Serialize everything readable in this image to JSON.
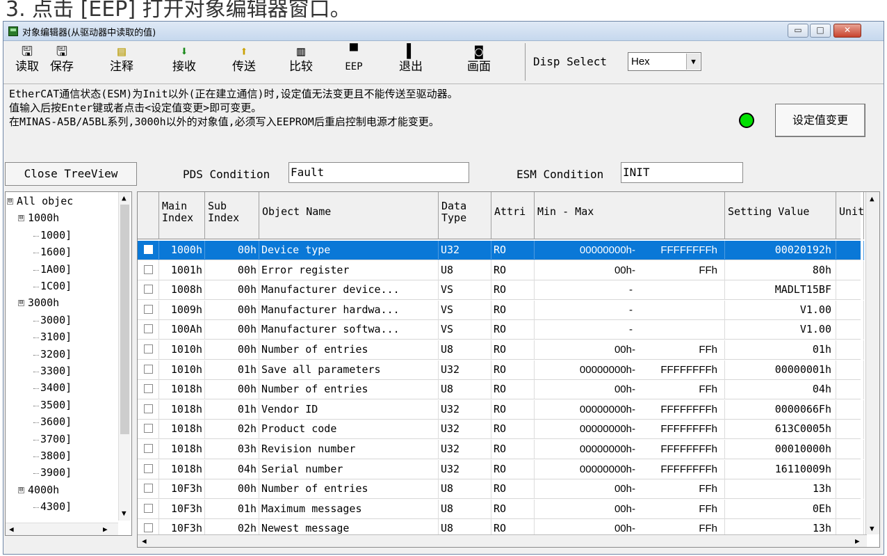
{
  "heading_fragment": "3. 点击 [EEP] 打开对象编辑器窗口。",
  "window": {
    "title": "对象编辑器(从驱动器中读取的值)",
    "min_label": "▭",
    "max_label": "□",
    "close_label": "✕"
  },
  "toolbar": {
    "buttons": [
      {
        "label": "读取",
        "icon": "save-floppy-icon"
      },
      {
        "label": "保存",
        "icon": "save-floppy-icon"
      },
      {
        "label": "注释",
        "icon": "note-icon"
      },
      {
        "label": "接收",
        "icon": "receive-icon"
      },
      {
        "label": "传送",
        "icon": "send-icon"
      },
      {
        "label": "比较",
        "icon": "compare-icon"
      },
      {
        "label": "EEP",
        "icon": "eep-icon"
      },
      {
        "label": "退出",
        "icon": "exit-icon"
      },
      {
        "label": "画面",
        "icon": "screen-capture-icon"
      }
    ],
    "disp_select_label": "Disp Select",
    "disp_select_value": "Hex"
  },
  "info_lines": [
    "EtherCAT通信状态(ESM)为Init以外(正在建立通信)时,设定值无法变更且不能传送至驱动器。",
    "值输入后按Enter键或者点击<设定值变更>即可变更。",
    "在MINAS-A5B/A5BL系列,3000h以外的对象值,必须写入EEPROM后重启控制电源才能变更。"
  ],
  "status_led_color": "#00e000",
  "change_button_label": "设定值变更",
  "close_tree_label": "Close TreeView",
  "pds": {
    "label": "PDS Condition",
    "value": "Fault"
  },
  "esm": {
    "label": "ESM Condition",
    "value": "INIT"
  },
  "tree": [
    {
      "text": "All objec",
      "level": 0,
      "box": "⊟"
    },
    {
      "text": "1000h",
      "level": 1,
      "box": "⊟"
    },
    {
      "text": "1000]",
      "level": 2
    },
    {
      "text": "1600]",
      "level": 2
    },
    {
      "text": "1A00]",
      "level": 2
    },
    {
      "text": "1C00]",
      "level": 2
    },
    {
      "text": "3000h",
      "level": 1,
      "box": "⊟"
    },
    {
      "text": "3000]",
      "level": 2
    },
    {
      "text": "3100]",
      "level": 2
    },
    {
      "text": "3200]",
      "level": 2
    },
    {
      "text": "3300]",
      "level": 2
    },
    {
      "text": "3400]",
      "level": 2
    },
    {
      "text": "3500]",
      "level": 2
    },
    {
      "text": "3600]",
      "level": 2
    },
    {
      "text": "3700]",
      "level": 2
    },
    {
      "text": "3800]",
      "level": 2
    },
    {
      "text": "3900]",
      "level": 2
    },
    {
      "text": "4000h",
      "level": 1,
      "box": "⊟"
    },
    {
      "text": "4300]",
      "level": 2
    }
  ],
  "table": {
    "headers": {
      "main": "Main\nIndex",
      "sub": "Sub\nIndex",
      "name": "Object Name",
      "dtype": "Data\nType",
      "attr": "Attri",
      "minmax": "Min - Max",
      "setting": "Setting Value",
      "unit": "Unit"
    },
    "rows": [
      {
        "main": "1000h",
        "sub": "00h",
        "name": "Device type",
        "type": "U32",
        "attr": "RO",
        "min": "00000000h-",
        "max": "FFFFFFFFh",
        "value": "00020192h",
        "selected": true
      },
      {
        "main": "1001h",
        "sub": "00h",
        "name": "Error register",
        "type": "U8",
        "attr": "RO",
        "min": "00h-",
        "max": "FFh",
        "value": "80h"
      },
      {
        "main": "1008h",
        "sub": "00h",
        "name": "Manufacturer device...",
        "type": "VS",
        "attr": "RO",
        "min": "-",
        "max": "",
        "value": "MADLT15BF"
      },
      {
        "main": "1009h",
        "sub": "00h",
        "name": "Manufacturer hardwa...",
        "type": "VS",
        "attr": "RO",
        "min": "-",
        "max": "",
        "value": "V1.00"
      },
      {
        "main": "100Ah",
        "sub": "00h",
        "name": "Manufacturer softwa...",
        "type": "VS",
        "attr": "RO",
        "min": "-",
        "max": "",
        "value": "V1.00"
      },
      {
        "main": "1010h",
        "sub": "00h",
        "name": "Number of entries",
        "type": "U8",
        "attr": "RO",
        "min": "00h-",
        "max": "FFh",
        "value": "01h"
      },
      {
        "main": "1010h",
        "sub": "01h",
        "name": "Save all parameters",
        "type": "U32",
        "attr": "RO",
        "min": "00000000h-",
        "max": "FFFFFFFFh",
        "value": "00000001h"
      },
      {
        "main": "1018h",
        "sub": "00h",
        "name": "Number of entries",
        "type": "U8",
        "attr": "RO",
        "min": "00h-",
        "max": "FFh",
        "value": "04h"
      },
      {
        "main": "1018h",
        "sub": "01h",
        "name": "Vendor ID",
        "type": "U32",
        "attr": "RO",
        "min": "00000000h-",
        "max": "FFFFFFFFh",
        "value": "0000066Fh"
      },
      {
        "main": "1018h",
        "sub": "02h",
        "name": "Product code",
        "type": "U32",
        "attr": "RO",
        "min": "00000000h-",
        "max": "FFFFFFFFh",
        "value": "613C0005h"
      },
      {
        "main": "1018h",
        "sub": "03h",
        "name": "Revision number",
        "type": "U32",
        "attr": "RO",
        "min": "00000000h-",
        "max": "FFFFFFFFh",
        "value": "00010000h"
      },
      {
        "main": "1018h",
        "sub": "04h",
        "name": "Serial number",
        "type": "U32",
        "attr": "RO",
        "min": "00000000h-",
        "max": "FFFFFFFFh",
        "value": "16110009h"
      },
      {
        "main": "10F3h",
        "sub": "00h",
        "name": "Number of entries",
        "type": "U8",
        "attr": "RO",
        "min": "00h-",
        "max": "FFh",
        "value": "13h"
      },
      {
        "main": "10F3h",
        "sub": "01h",
        "name": "Maximum messages",
        "type": "U8",
        "attr": "RO",
        "min": "00h-",
        "max": "FFh",
        "value": "0Eh"
      },
      {
        "main": "10F3h",
        "sub": "02h",
        "name": "Newest message",
        "type": "U8",
        "attr": "RO",
        "min": "00h-",
        "max": "FFh",
        "value": "13h"
      }
    ]
  }
}
